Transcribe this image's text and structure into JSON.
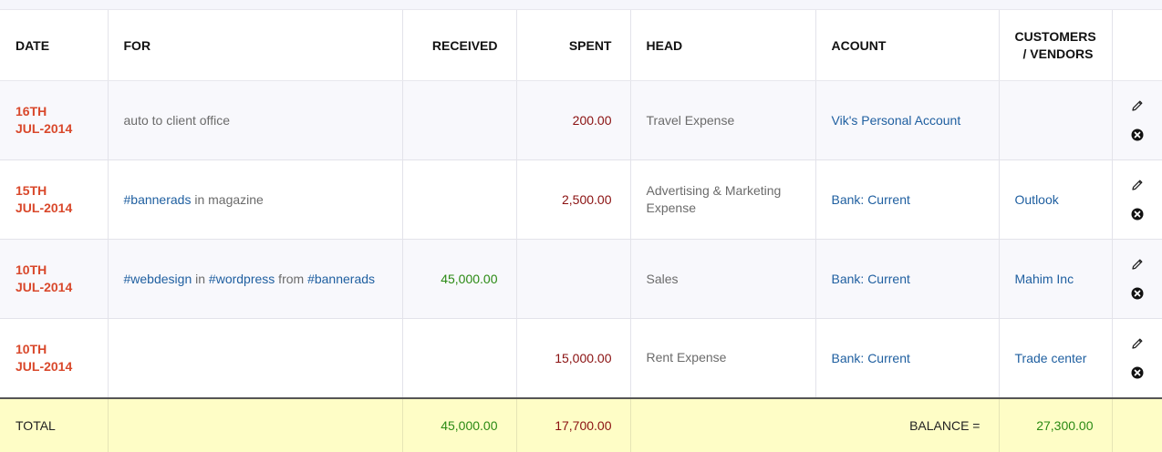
{
  "columns": {
    "date": "DATE",
    "for": "FOR",
    "received": "RECEIVED",
    "spent": "SPENT",
    "head": "HEAD",
    "account": "ACOUNT",
    "customers_line1": "CUSTOMERS",
    "customers_line2": "/ VENDORS"
  },
  "rows": [
    {
      "date_line1": "16TH",
      "date_line2": "JUL-2014",
      "for": [
        {
          "text": "auto to client office",
          "tag": false
        }
      ],
      "received": "",
      "spent": "200.00",
      "head": "Travel Expense",
      "account": "Vik's Personal Account",
      "customer": ""
    },
    {
      "date_line1": "15TH",
      "date_line2": "JUL-2014",
      "for": [
        {
          "text": "#bannerads",
          "tag": true
        },
        {
          "text": " in magazine",
          "tag": false
        }
      ],
      "received": "",
      "spent": "2,500.00",
      "head": "Advertising & Marketing Expense",
      "account": "Bank: Current",
      "customer": "Outlook"
    },
    {
      "date_line1": "10TH",
      "date_line2": "JUL-2014",
      "for": [
        {
          "text": "#webdesign",
          "tag": true
        },
        {
          "text": " in ",
          "tag": false
        },
        {
          "text": "#wordpress",
          "tag": true
        },
        {
          "text": " from ",
          "tag": false
        },
        {
          "text": "#bannerads",
          "tag": true
        }
      ],
      "received": "45,000.00",
      "spent": "",
      "head": "Sales",
      "account": "Bank: Current",
      "customer": "Mahim Inc"
    },
    {
      "date_line1": "10TH",
      "date_line2": "JUL-2014",
      "for": [],
      "received": "",
      "spent": "15,000.00",
      "head": "Rent Expense",
      "account": "Bank: Current",
      "customer": "Trade center"
    }
  ],
  "totals": {
    "label": "TOTAL",
    "received": "45,000.00",
    "spent": "17,700.00",
    "balance_label": "BALANCE =",
    "balance_value": "27,300.00"
  },
  "icons": {
    "edit": "pencil-icon",
    "delete": "close-circle-icon"
  }
}
